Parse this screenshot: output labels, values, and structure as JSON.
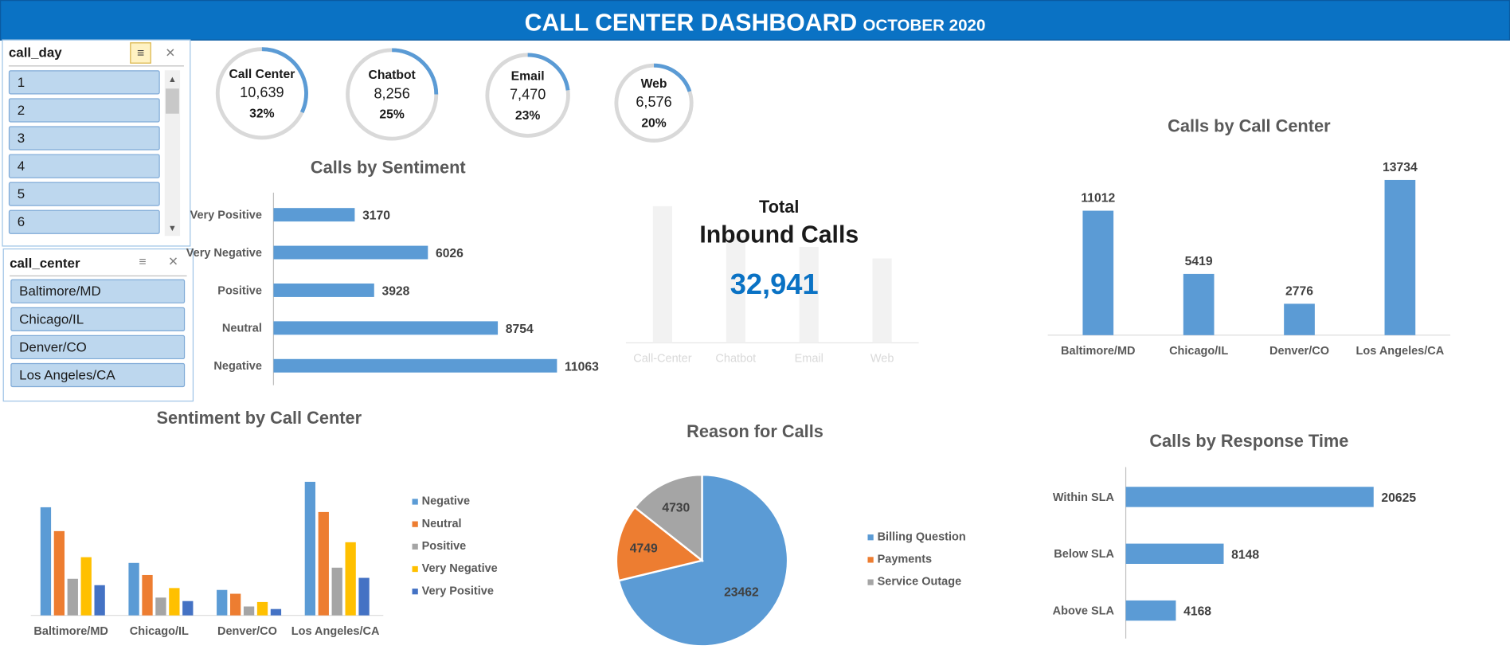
{
  "header": {
    "title": "CALL CENTER DASHBOARD",
    "subtitle": "OCTOBER 2020"
  },
  "colors": {
    "header_bg": "#0a72c4",
    "bar_blue": "#5b9bd5",
    "orange": "#ed7d31",
    "gray": "#a5a5a5",
    "gold": "#ffc000",
    "dark_blue": "#4472c4",
    "total_value": "#0a72c4"
  },
  "slicers": {
    "call_day": {
      "label": "call_day",
      "items": [
        "1",
        "2",
        "3",
        "4",
        "5",
        "6"
      ],
      "icons": [
        "multi-select-icon",
        "clear-filter-icon"
      ]
    },
    "call_center": {
      "label": "call_center",
      "items": [
        "Baltimore/MD",
        "Chicago/IL",
        "Denver/CO",
        "Los Angeles/CA"
      ],
      "icons": [
        "multi-select-icon",
        "clear-filter-icon"
      ]
    }
  },
  "kpis": [
    {
      "name": "Call Center",
      "value": "10,639",
      "pct": "32%",
      "fraction": 0.32
    },
    {
      "name": "Chatbot",
      "value": "8,256",
      "pct": "25%",
      "fraction": 0.25
    },
    {
      "name": "Email",
      "value": "7,470",
      "pct": "23%",
      "fraction": 0.23
    },
    {
      "name": "Web",
      "value": "6,576",
      "pct": "20%",
      "fraction": 0.2
    }
  ],
  "total": {
    "line1": "Total",
    "line2": "Inbound Calls",
    "value": "32,941"
  },
  "chart_data": [
    {
      "id": "sentiment",
      "type": "bar",
      "orientation": "horizontal",
      "title": "Calls by Sentiment",
      "categories": [
        "Very Positive",
        "Very Negative",
        "Positive",
        "Neutral",
        "Negative"
      ],
      "values": [
        3170,
        6026,
        3928,
        8754,
        11063
      ],
      "xlim": [
        0,
        11500
      ]
    },
    {
      "id": "channel",
      "type": "bar",
      "title": "",
      "categories": [
        "Call-Center",
        "Chatbot",
        "Email",
        "Web"
      ],
      "values": [
        10639,
        8256,
        7470,
        6576
      ],
      "ylim": [
        0,
        12000
      ]
    },
    {
      "id": "callcenter",
      "type": "bar",
      "title": "Calls by Call Center",
      "categories": [
        "Baltimore/MD",
        "Chicago/IL",
        "Denver/CO",
        "Los Angeles/CA"
      ],
      "values": [
        11012,
        5419,
        2776,
        13734
      ],
      "ylim": [
        0,
        15000
      ]
    },
    {
      "id": "sentiment_by_center",
      "type": "bar",
      "title": "Sentiment by Call Center",
      "categories": [
        "Baltimore/MD",
        "Chicago/IL",
        "Denver/CO",
        "Los Angeles/CA"
      ],
      "series": [
        {
          "name": "Negative",
          "values": [
            3400,
            1650,
            800,
            4200
          ]
        },
        {
          "name": "Neutral",
          "values": [
            2650,
            1270,
            680,
            3250
          ]
        },
        {
          "name": "Positive",
          "values": [
            1150,
            560,
            280,
            1500
          ]
        },
        {
          "name": "Very Negative",
          "values": [
            1830,
            860,
            420,
            2300
          ]
        },
        {
          "name": "Very Positive",
          "values": [
            950,
            450,
            200,
            1180
          ]
        }
      ],
      "ylim": [
        0,
        4300
      ],
      "legend": "right"
    },
    {
      "id": "reasons",
      "type": "pie",
      "title": "Reason for Calls",
      "labels": [
        "Billing Question",
        "Payments",
        "Service Outage"
      ],
      "values": [
        23462,
        4749,
        4730
      ],
      "legend": "right"
    },
    {
      "id": "response",
      "type": "bar",
      "orientation": "horizontal",
      "title": "Calls by Response Time",
      "categories": [
        "Within SLA",
        "Below SLA",
        "Above SLA"
      ],
      "values": [
        20625,
        8148,
        4168
      ],
      "xlim": [
        0,
        23000
      ]
    }
  ]
}
